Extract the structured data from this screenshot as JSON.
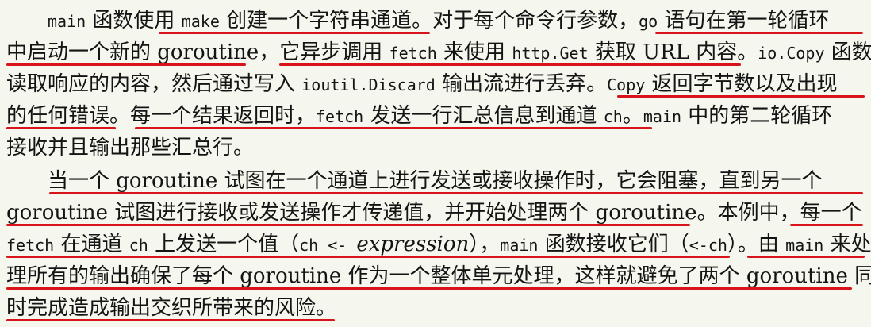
{
  "document": {
    "paragraphs": [
      {
        "lines": [
          {
            "indent": true,
            "segments": [
              {
                "text": "main",
                "style": "code"
              },
              {
                "text": " 函数使用 ",
                "style": "plain"
              },
              {
                "text": "make",
                "style": "code"
              },
              {
                "text": " 创建一个字符串通道。对于每个命令行参数，",
                "style": "plain"
              },
              {
                "text": "go",
                "style": "code"
              },
              {
                "text": " 语句在第一轮循环",
                "style": "plain"
              }
            ]
          },
          {
            "indent": false,
            "segments": [
              {
                "text": "中启动一个新的 goroutine，它异步调用 ",
                "style": "plain"
              },
              {
                "text": "fetch",
                "style": "code"
              },
              {
                "text": " 来使用 ",
                "style": "plain"
              },
              {
                "text": "http.Get",
                "style": "code"
              },
              {
                "text": " 获取 URL 内容。",
                "style": "plain"
              },
              {
                "text": "io.Copy",
                "style": "code"
              },
              {
                "text": " 函数",
                "style": "plain"
              }
            ]
          },
          {
            "indent": false,
            "segments": [
              {
                "text": "读取响应的内容，然后通过写入 ",
                "style": "plain"
              },
              {
                "text": "ioutil.Discard",
                "style": "code"
              },
              {
                "text": " 输出流进行丢弃。",
                "style": "plain"
              },
              {
                "text": "Copy",
                "style": "code"
              },
              {
                "text": " 返回字节数以及出现",
                "style": "plain"
              }
            ]
          },
          {
            "indent": false,
            "segments": [
              {
                "text": "的任何错误。每一个结果返回时，",
                "style": "plain"
              },
              {
                "text": "fetch",
                "style": "code"
              },
              {
                "text": " 发送一行汇总信息到通道 ",
                "style": "plain"
              },
              {
                "text": "ch",
                "style": "code"
              },
              {
                "text": "。",
                "style": "plain"
              },
              {
                "text": "main",
                "style": "code"
              },
              {
                "text": " 中的第二轮循环",
                "style": "plain"
              }
            ]
          },
          {
            "indent": false,
            "segments": [
              {
                "text": "接收并且输出那些汇总行。",
                "style": "plain"
              }
            ]
          }
        ]
      },
      {
        "lines": [
          {
            "indent": true,
            "segments": [
              {
                "text": "当一个 goroutine 试图在一个通道上进行发送或接收操作时，它会阻塞，直到另一个",
                "style": "plain"
              }
            ]
          },
          {
            "indent": false,
            "segments": [
              {
                "text": "goroutine 试图进行接收或发送操作才传递值，并开始处理两个 goroutine。本例中，每一个",
                "style": "plain"
              }
            ]
          },
          {
            "indent": false,
            "segments": [
              {
                "text": "fetch",
                "style": "code"
              },
              {
                "text": " 在通道 ",
                "style": "plain"
              },
              {
                "text": "ch",
                "style": "code"
              },
              {
                "text": " 上发送一个值（",
                "style": "plain"
              },
              {
                "text": "ch <- ",
                "style": "code"
              },
              {
                "text": "expression",
                "style": "italic"
              },
              {
                "text": "），",
                "style": "plain"
              },
              {
                "text": "main",
                "style": "code"
              },
              {
                "text": " 函数接收它们（",
                "style": "plain"
              },
              {
                "text": "<-ch",
                "style": "code"
              },
              {
                "text": "）。由 ",
                "style": "plain"
              },
              {
                "text": "main",
                "style": "code"
              },
              {
                "text": " 来处",
                "style": "plain"
              }
            ]
          },
          {
            "indent": false,
            "segments": [
              {
                "text": "理所有的输出确保了每个 goroutine 作为一个整体单元处理，这样就避免了两个 goroutine 同",
                "style": "plain"
              }
            ]
          },
          {
            "indent": false,
            "segments": [
              {
                "text": "时完成造成输出交织所带来的风险。",
                "style": "plain"
              }
            ]
          }
        ]
      }
    ],
    "highlight_color": "#d8141b"
  }
}
